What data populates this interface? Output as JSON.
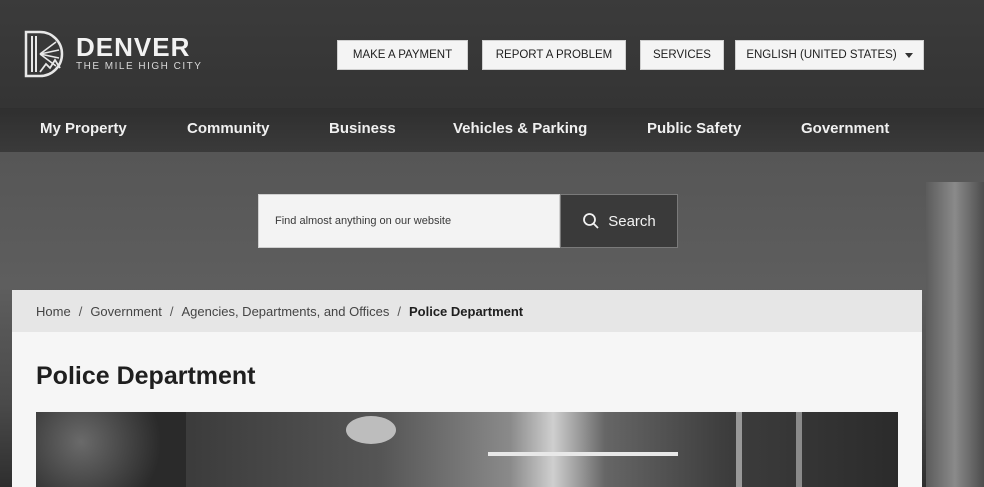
{
  "brand": {
    "name": "DENVER",
    "tagline": "THE MILE HIGH CITY"
  },
  "utility": {
    "payment": "MAKE A PAYMENT",
    "report": "REPORT A PROBLEM",
    "services": "SERVICES",
    "language": "ENGLISH (UNITED STATES)"
  },
  "nav": {
    "items": [
      {
        "label": "My Property"
      },
      {
        "label": "Community"
      },
      {
        "label": "Business"
      },
      {
        "label": "Vehicles & Parking"
      },
      {
        "label": "Public Safety"
      },
      {
        "label": "Government"
      }
    ]
  },
  "search": {
    "placeholder": "Find almost anything on our website",
    "button_label": "Search"
  },
  "breadcrumb": {
    "items": [
      "Home",
      "Government",
      "Agencies, Departments, and Offices"
    ],
    "current": "Police Department"
  },
  "page": {
    "title": "Police Department"
  },
  "colors": {
    "header_bg": "#3b3b3b",
    "nav_bg": "#333333",
    "panel_bg": "#f6f6f6",
    "crumb_bg": "#e6e6e6"
  },
  "icons": {
    "logo": "denver-sun-mountain-logo",
    "search": "search-icon",
    "caret": "chevron-down-icon"
  }
}
